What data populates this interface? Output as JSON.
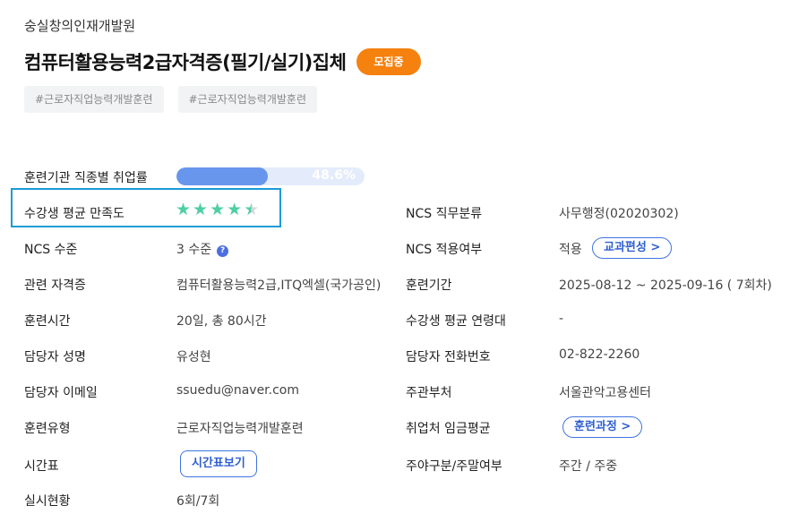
{
  "institution": "숭실창의인재개발원",
  "course_title": "컴퓨터활용능력2급자격증(필기/실기)집체",
  "status_badge": "모집중",
  "tags": [
    "#근로자직업능력개발훈련",
    "#근로자직업능력개발훈련"
  ],
  "employment_rate": {
    "label": "훈련기관 직종별 취업률",
    "value_text": "48.6%",
    "fraction": 0.486
  },
  "satisfaction": {
    "label": "수강생 평균 만족도",
    "rating": 4.5,
    "max": 5
  },
  "left": {
    "ncs_level_label": "NCS 수준",
    "ncs_level_value": "3 수준",
    "cert_label": "관련 자격증",
    "cert_value": "컴퓨터활용능력2급,ITQ엑셀(국가공인)",
    "hours_label": "훈련시간",
    "hours_value": "20일, 총 80시간",
    "manager_label": "담당자 성명",
    "manager_value": "유성현",
    "email_label": "담당자 이메일",
    "email_value": "ssuedu@naver.com",
    "type_label": "훈련유형",
    "type_value": "근로자직업능력개발훈련",
    "timetable_label": "시간표",
    "timetable_button": "시간표보기",
    "status_label": "실시현황",
    "status_value": "6회/7회"
  },
  "right": {
    "ncs_class_label": "NCS 직무분류",
    "ncs_class_value": "사무행정(02020302)",
    "ncs_apply_label": "NCS 적용여부",
    "ncs_apply_value": "적용",
    "curriculum_button": "교과편성 >",
    "period_label": "훈련기간",
    "period_value": "2025-08-12 ~ 2025-09-16 ( 7회차)",
    "age_label": "수강생 평균 연령대",
    "age_value": "-",
    "phone_label": "담당자 전화번호",
    "phone_value": "02-822-2260",
    "dept_label": "주관부처",
    "dept_value": "서울관악고용센터",
    "wage_label": "취업처 임금평균",
    "course_button": "훈련과정 >",
    "daynight_label": "주야구분/주말여부",
    "daynight_value": "주간 / 주중"
  },
  "colors": {
    "accent_orange": "#f5810f",
    "bar_blue": "#6796ec",
    "star_green": "#4ecfa6",
    "link_blue": "#3f74e0",
    "highlight": "#1b9bd8"
  }
}
